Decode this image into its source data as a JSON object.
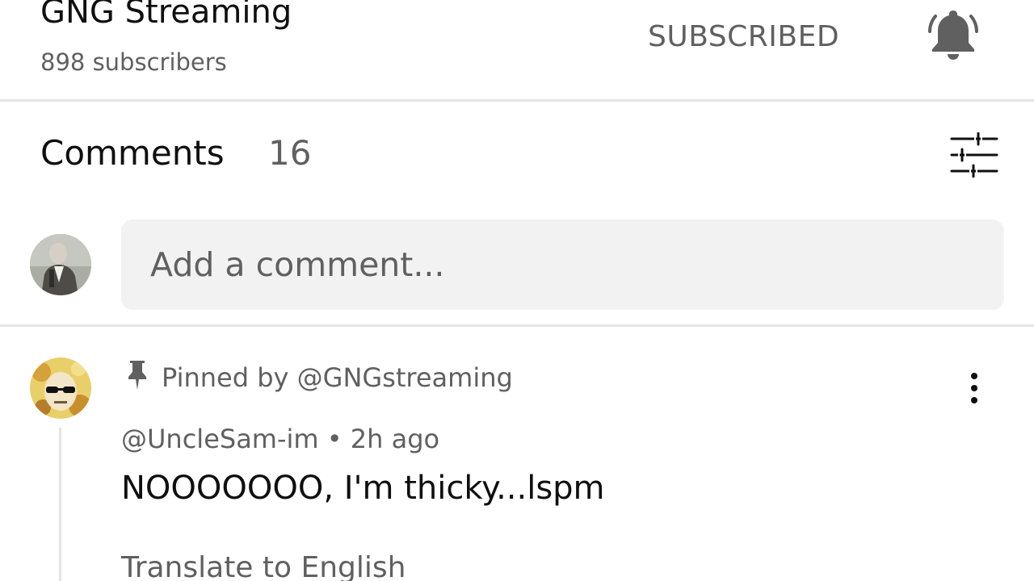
{
  "channel": {
    "name": "GNG Streaming",
    "subscribers": "898 subscribers",
    "subscribe_label": "SUBSCRIBED",
    "bell_icon": "bell-icon"
  },
  "comments_section": {
    "title": "Comments",
    "count": "16",
    "sort_icon": "sliders-icon",
    "input_placeholder": "Add a comment..."
  },
  "comment": {
    "pinned_by": "Pinned by @GNGstreaming",
    "author": "@UncleSam-im",
    "time": "2h ago",
    "meta": "@UncleSam-im • 2h ago",
    "text": "NOOOOOOO, I'm thicky...lspm",
    "translate_label": "Translate to English"
  },
  "colors": {
    "primary_text": "#0f0f0f",
    "secondary_text": "#606060",
    "divider": "#e5e5e5",
    "input_bg": "#f2f2f2"
  }
}
